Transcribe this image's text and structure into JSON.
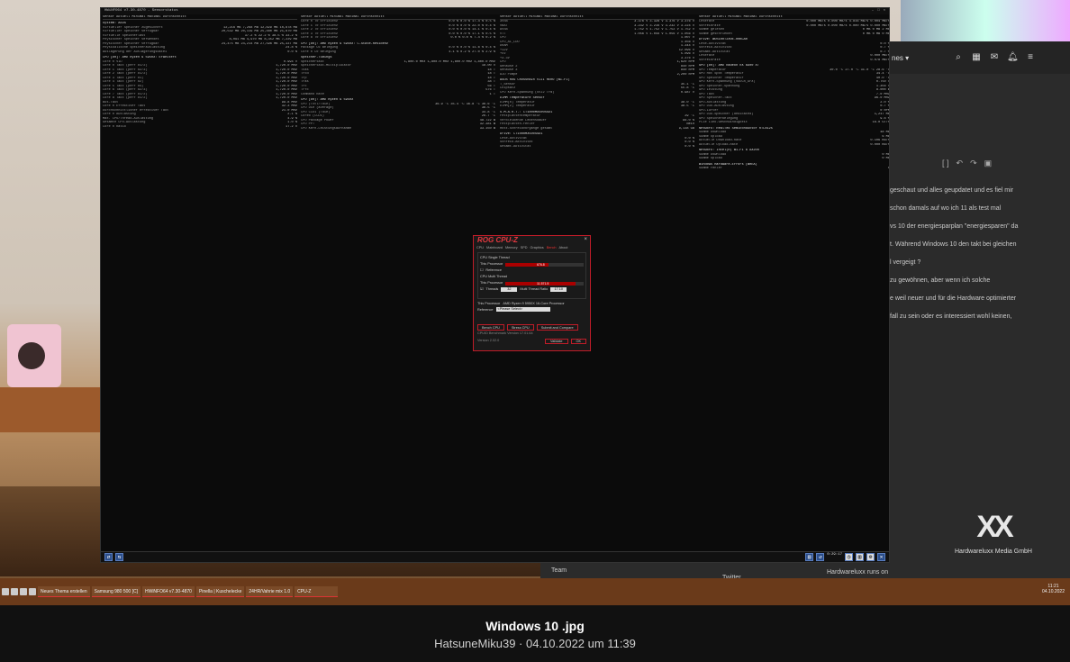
{
  "caption": {
    "title": "Windows 10 .jpg",
    "subtitle": "HatsuneMiku39 · 04.10.2022 um 11:39"
  },
  "hwinfo": {
    "title": "HWiNFO64 v7.30-4870 - Sensorstatus",
    "headers": [
      "Sensor",
      "Aktuell",
      "Minimal",
      "Maximal",
      "Durchschnitt"
    ],
    "col1": [
      {
        "s": true,
        "t": "System: ASUS"
      },
      {
        "t": "Virtueller Speicher zugesichert",
        "v": [
          "12,216 MB",
          "7,268 MB",
          "12,629 MB",
          "10,878 MB"
        ]
      },
      {
        "t": "Virtueller Speicher verfügbar",
        "v": [
          "20,532 MB",
          "20,119 MB",
          "25,480 MB",
          "21,870 MB"
        ]
      },
      {
        "t": "Virtuelle Speicherlast",
        "v": [
          "37.2 %",
          "22.2 %",
          "38.5 %",
          "33.2 %"
        ]
      },
      {
        "t": "Physischer Speicher verwendet",
        "v": [
          "8,091 MB",
          "4,970 MB",
          "8,352 MB",
          "7,229 MB"
        ]
      },
      {
        "t": "Physischer Speicher verfügbar",
        "v": [
          "24,475 MB",
          "24,214 MB",
          "27,596 MB",
          "25,337 MB"
        ]
      },
      {
        "t": "Physikalische Speicherauslastung",
        "v": "24.8 %"
      },
      {
        "t": "Auslagerung der Auslagerungsdatei",
        "v": "0.0 %"
      },
      {
        "s": true,
        "t": "CPU [#0]: AMD Ryzen 9 5950X: Erweitert"
      },
      {
        "t": "Core 0 VID",
        "v": "0.994 V"
      },
      {
        "t": "Core 0 Takt (perf #1/2)",
        "v": "1,720.0 MHz"
      },
      {
        "t": "Core 1 Takt (perf #2/3)",
        "v": "1,720.0 MHz"
      },
      {
        "t": "Core 2 Takt (perf #1/2)",
        "v": "1,720.0 MHz"
      },
      {
        "t": "Core 3 Takt (perf #1)",
        "v": "1,720.0 MHz"
      },
      {
        "t": "Core 4 Takt (perf #2)",
        "v": "1,720.0 MHz"
      },
      {
        "t": "Core 5 Takt (perf #4)",
        "v": "1,720.0 MHz"
      },
      {
        "t": "Core 6 Takt (perf #2/3)",
        "v": "1,720.0 MHz"
      },
      {
        "t": "Core 7 Takt (perf #1/2)",
        "v": "1,720.0 MHz"
      },
      {
        "t": "Core 8 Takt (perf #1/2)",
        "v": "1,720.0 MHz"
      },
      {
        "t": "Bus-Takt",
        "v": "99.8 MHz"
      },
      {
        "t": "Core 0 Effektiver Takt",
        "v": "32.3 MHz"
      },
      {
        "t": "Durchschnittlicher effektiver Takt",
        "v": "21.0 MHz"
      },
      {
        "t": "Core 0 Auslastung",
        "v": "2.1 %"
      },
      {
        "t": "Max. CPU/Thread-Auslastung",
        "v": "4.9 %"
      },
      {
        "t": "Gesamte CPU-Auslastung",
        "v": "1.0 %"
      },
      {
        "t": "Core 0 Ratio",
        "v": "17.2 x"
      }
    ],
    "col2": [
      {
        "t": "Core 0 T0 Effizienz",
        "v": [
          "0.0 %",
          "0.0 %",
          "17.4 %",
          "0.5 %"
        ]
      },
      {
        "t": "Core 1 T0 Effizienz",
        "v": [
          "0.0 %",
          "0.0 %",
          "22.0 %",
          "0.4 %"
        ]
      },
      {
        "t": "Core 2 T0 Effizienz",
        "v": [
          "0.0 %",
          "0.0 %",
          "14.1 %",
          "0.4 %"
        ]
      },
      {
        "t": "Core 3 T0 Effizienz",
        "v": [
          "0.0 %",
          "0.0 %",
          "17.1 %",
          "0.5 %"
        ]
      },
      {
        "t": "Core 8 T0 Effizienz",
        "v": [
          "0.0 %",
          "0.0 %",
          "7.4 %",
          "0.2 %"
        ]
      },
      {
        "s": true,
        "t": "CPU [#0]: AMD Ryzen 9 5950X: C-State-Residenz"
      },
      {
        "t": "Package C6 Belegung",
        "v": [
          "0.0 %",
          "0.0 %",
          "11.6 %",
          "0.4 %"
        ]
      },
      {
        "t": "Core 0 C0 Belegung",
        "v": [
          "4.1 %",
          "0.2 %",
          "27.0 %",
          "2.9 %"
        ]
      },
      {
        "s": true,
        "t": "Speicher-Timings"
      },
      {
        "t": "Speichertakt",
        "v": [
          "1,800.0 MHz",
          "1,800.0 MHz",
          "1,800.0 MHz",
          "1,800.0 MHz"
        ]
      },
      {
        "t": "Speichertakt-Multiplikator",
        "v": "18.00 x"
      },
      {
        "t": "Tcas",
        "v": "18 T"
      },
      {
        "t": "Trcd",
        "v": "18 T"
      },
      {
        "t": "Trp",
        "v": "18 T"
      },
      {
        "t": "Tras",
        "v": "38 T"
      },
      {
        "t": "Trc",
        "v": "56 T"
      },
      {
        "t": "Trfc",
        "v": "576 T"
      },
      {
        "t": "Command Rate",
        "v": "1 T"
      },
      {
        "s": true,
        "t": "CPU [#0]: AMD Ryzen 9 5950X"
      },
      {
        "t": "CPU (Tctl/Tdie)",
        "v": [
          "36.9 °C",
          "35.4 °C",
          "36.8 °C",
          "36.6 °C"
        ]
      },
      {
        "t": "CPU Die (average)",
        "v": "36.5 °C"
      },
      {
        "t": "CPU CCD1 (Tdie)",
        "v": "34.8 °C"
      },
      {
        "t": "Core0 (CCD1)",
        "v": "26.7 °C"
      },
      {
        "t": "CPU Package Power",
        "v": "48.722 W"
      },
      {
        "t": "CPU PPT",
        "v": "32.381 W"
      },
      {
        "t": "CPU Kern-Leistungsaufnahme",
        "v": "33.150 W"
      }
    ],
    "col3": [
      {
        "t": "3VSB",
        "v": [
          "3.376 V",
          "3.328 V",
          "3.376 V",
          "3.376 V"
        ]
      },
      {
        "t": "VBAT",
        "v": [
          "3.232 V",
          "3.216 V",
          "3.232 V",
          "3.224 V"
        ]
      },
      {
        "t": "AVSB",
        "v": [
          "1.752 V",
          "1.752 V",
          "1.752 V",
          "1.752 V"
        ]
      },
      {
        "t": "VTT",
        "v": [
          "1.056 V",
          "1.056 V",
          "1.056 V",
          "1.056 V"
        ]
      },
      {
        "t": "CPU",
        "v": "1.007 V"
      },
      {
        "t": "CPU_AL_LDO",
        "v": "1.456 V"
      },
      {
        "t": "DRAM",
        "v": "1.344 V"
      },
      {
        "t": "+12V",
        "v": "12.096 V"
      },
      {
        "t": "+5V",
        "v": "5.096 V"
      },
      {
        "t": "+3.3V",
        "v": "3.376 V"
      },
      {
        "t": "CPU",
        "v": "1,620 RPM"
      },
      {
        "t": "Gehäuse 2",
        "v": "840 RPM"
      },
      {
        "t": "Gehäuse 3",
        "v": "840 RPM"
      },
      {
        "t": "AIO Pumpe",
        "v": "2,200 RPM"
      },
      {
        "s": true,
        "t": "ASUS ROG CROSSHAIR VIII HERO (WI-FI)"
      },
      {
        "t": "T_Sensor",
        "v": "35.1 °C"
      },
      {
        "t": "Chipsatz",
        "v": "55.8 °C"
      },
      {
        "t": "CPU Kern-Spannung (SVI2 TFN)",
        "v": "0.987 V"
      },
      {
        "s": true,
        "t": "DIMM Temperature Sensor"
      },
      {
        "t": "DIMM[0] Temperatur",
        "v": "38.0 °C"
      },
      {
        "t": "DIMM[2] Temperatur",
        "v": "38.5 °C"
      },
      {
        "s": true,
        "t": "S.M.A.R.T.: CT1000MX500SSD1"
      },
      {
        "t": "Festplattentemperatur",
        "v": "29 °C"
      },
      {
        "t": "Verbleibende Lebensdauer",
        "v": "96.0 %"
      },
      {
        "t": "Festplatten-Fehler",
        "v": "Nein"
      },
      {
        "t": "Host-Schreibvorgänge gesamt",
        "v": "9,138 GB"
      },
      {
        "s": true,
        "t": "Drive: CT1000MX500SSD1"
      },
      {
        "t": "Lese-Aktivität",
        "v": "0.0 %"
      },
      {
        "t": "Schreib-Aktivität",
        "v": "0.0 %"
      },
      {
        "t": "Gesamt-Aktivität",
        "v": "0.0 %"
      }
    ],
    "col4": [
      {
        "t": "Leserate",
        "v": [
          "0.000 MB/s",
          "0.000 MB/s",
          "4.816 MB/s",
          "0.004 MB/s"
        ]
      },
      {
        "t": "Schreibrate",
        "v": [
          "0.000 MB/s",
          "0.000 MB/s",
          "0.000 MB/s",
          "0.000 MB/s"
        ]
      },
      {
        "t": "Summe gelesen",
        "v": [
          "0 MB",
          "0 MB",
          "2 MB"
        ]
      },
      {
        "t": "Summe geschrieben",
        "v": [
          "0 MB",
          "0 MB",
          "0 MB"
        ]
      },
      {
        "s": true,
        "t": "Drive: WDS100T2X0E-00BCA0"
      },
      {
        "t": "Lese-Aktivität",
        "v": "0.0 %"
      },
      {
        "t": "Schreib-Aktivität",
        "v": "0.7 %"
      },
      {
        "t": "Gesamt-Aktivität",
        "v": "0.7 %"
      },
      {
        "t": "Leserate",
        "v": "0.000 MB/s"
      },
      {
        "t": "Schreibrate",
        "v": "0.078 MB/s"
      },
      {
        "s": true,
        "t": "GPU [#0]: AMD Radeon RX 6900 XT"
      },
      {
        "t": "GPU Temperatur",
        "v": [
          "30.0 °C",
          "27.0 °C",
          "31.0 °C",
          "28.6 °C"
        ]
      },
      {
        "t": "GPU Hot Spot Temperatur",
        "v": "34.4 °C"
      },
      {
        "t": "GPU Speicher Temperatur",
        "v": "40.0 °C"
      },
      {
        "t": "GPU Kern-Spannung (VDDCR_GFX)",
        "v": "0.750 V"
      },
      {
        "t": "GPU Speicher-Spannung",
        "v": "1.356 V"
      },
      {
        "t": "GPU Leistung",
        "v": "8.000 W"
      },
      {
        "t": "GPU Takt",
        "v": "7.0 MHz"
      },
      {
        "t": "GPU Speicher-Takt",
        "v": "96.0 MHz"
      },
      {
        "t": "GPU-Auslastung",
        "v": "2.0 %"
      },
      {
        "t": "GPU D3D-Auslastung",
        "v": "0.7 %"
      },
      {
        "t": "GPU-Lüfter",
        "v": "0 RPM"
      },
      {
        "t": "GPU D3D-Speicher (dedicated)",
        "v": "1,247 MB"
      },
      {
        "t": "GPU Speicherbelegung",
        "v": "9.6 %"
      },
      {
        "t": "PCIe Link-Geschwindigkeit",
        "v": "16.0 GT/s"
      },
      {
        "s": true,
        "t": "Network: RealTek Semiconductor RTL8125"
      },
      {
        "t": "Summe Download",
        "v": "48 MB"
      },
      {
        "t": "Summe Upload",
        "v": "6 MB"
      },
      {
        "t": "Aktuelle Download-Rate",
        "v": "0.106 KB/s"
      },
      {
        "t": "Aktuelle Upload-Rate",
        "v": "0.000 KB/s"
      },
      {
        "s": true,
        "t": "Network: Intel(R) Wi-Fi 6 AX200"
      },
      {
        "t": "Summe Download",
        "v": "0 MB"
      },
      {
        "t": "Summe Upload",
        "v": "0 MB"
      },
      {
        "s": true,
        "t": "Windows Hardware-Errors (WHEA)"
      },
      {
        "t": "Summe Fehler",
        "v": "0"
      }
    ],
    "status_time": "0:29:17"
  },
  "cpuz": {
    "logo": "ROG CPU-Z",
    "close": "×",
    "tabs": [
      "CPU",
      "Mainboard",
      "Memory",
      "SPD",
      "Graphics",
      "Bench",
      "About"
    ],
    "active_tab": "Bench",
    "single_label": "CPU Single Thread",
    "this_processor": "This Processor",
    "this_value": "676.8",
    "reference": "Reference",
    "multi_label": "CPU Multi Thread",
    "multi_value": "11.571.5",
    "threads_label": "Threads",
    "threads_value": "32",
    "multi_ratio": "Multi Thread Ratio",
    "ratio_value": "17.10",
    "this_processor2": "This Processor",
    "processor_name": "AMD Ryzen 9 5950X 16-Core Processor",
    "reference2": "Reference",
    "reference_select": "<Please Select>",
    "btn_bench": "Bench CPU",
    "btn_stress": "Stress CPU",
    "btn_submit": "Submit and Compare",
    "bench_version": "CPUID Benchmark Version 17.01.64",
    "version": "Version 2.02.0",
    "btn_validate": "Validate",
    "btn_ok": "OK"
  },
  "forum": {
    "label": "nes ▾",
    "toolbar_icons": [
      "search-icon",
      "grid-icon",
      "mail-icon",
      "bell-icon",
      "menu-icon"
    ],
    "lines": [
      "geschaut und alles geupdatet und es fiel mir",
      "schon damals auf wo ich 11 als test mal",
      "vs 10 der energiesparplan \"energiesparen\" da",
      "t. Während Windows 10 den takt bei gleichen",
      "l vergeigt ?",
      "zu gewöhnen, aber wenn ich solche",
      "e weil neuer und für die Hardware optimierter",
      "fall zu sein oder es interessiert wohl keinen,"
    ],
    "ad_caption": "Hardwareluxx Media GmbH",
    "bottom_team": "Team",
    "bottom_twitter": "Twitter",
    "bottom_runs": "Hardwareluxx runs on"
  },
  "taskbar": {
    "items": [
      "Neues Thema erstellen",
      "Samsung 980 500 [C]",
      "HWiNFO64 v7.30-4870",
      "Pinella | Kuschelecke",
      "24HR/Vahrie mix 1.0",
      "CPU-Z"
    ],
    "time": "11:21",
    "date": "04.10.2022"
  },
  "colors": {
    "accent_red": "#c01c28",
    "window_bg": "#0b0b0b",
    "caption_bg": "#111111"
  }
}
